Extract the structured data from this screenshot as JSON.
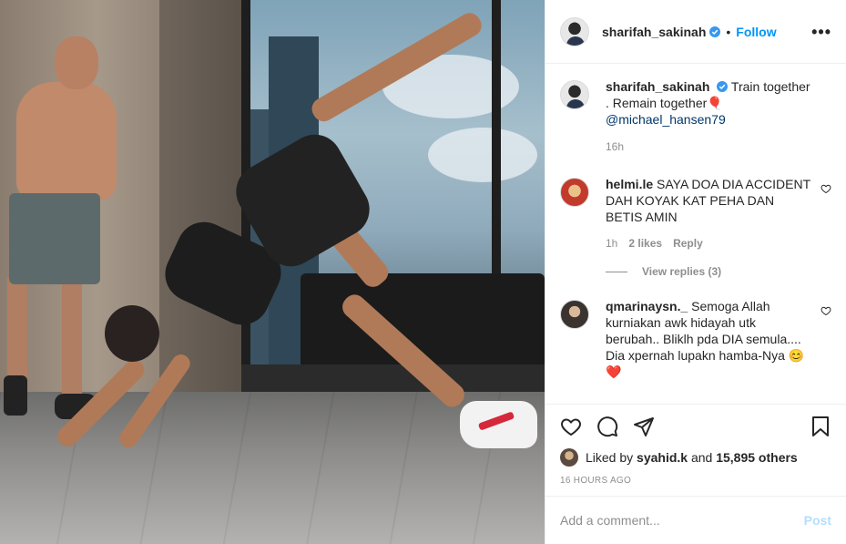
{
  "post": {
    "author": {
      "username": "sharifah_sakinah",
      "verified": true,
      "follow_label": "Follow",
      "separator": "•"
    },
    "more_label": "•••",
    "caption": {
      "username": "sharifah_sakinah",
      "text": "Train together . Remain together",
      "emoji": "🎈",
      "mention": "@michael_hansen79",
      "age": "16h"
    },
    "comments": [
      {
        "username": "helmi.le",
        "text": "SAYA DOA DIA ACCIDENT DAH KOYAK KAT PEHA DAN BETIS AMIN",
        "age": "1h",
        "likes": "2 likes",
        "reply_label": "Reply",
        "view_replies": "View replies (3)"
      },
      {
        "username": "qmarinaysn._",
        "text": "Semoga Allah kurniakan awk hidayah utk berubah.. Bliklh pda DIA semula.... Dia xpernah lupakn hamba-Nya",
        "emoji": "😊 ❤️"
      }
    ],
    "liked_by": {
      "prefix": "Liked by",
      "user": "syahid.k",
      "and": "and",
      "others": "15,895 others"
    },
    "posted_ago": "16 HOURS AGO",
    "add_comment": {
      "placeholder": "Add a comment...",
      "post_label": "Post"
    }
  },
  "icons": [
    "verified-badge-icon",
    "more-options-icon",
    "heart-icon",
    "comment-icon",
    "share-icon",
    "bookmark-icon"
  ],
  "colors": {
    "link": "#0095f6",
    "mention": "#00376b",
    "muted": "#8e8e8e",
    "post_disabled": "#b2dffc"
  }
}
